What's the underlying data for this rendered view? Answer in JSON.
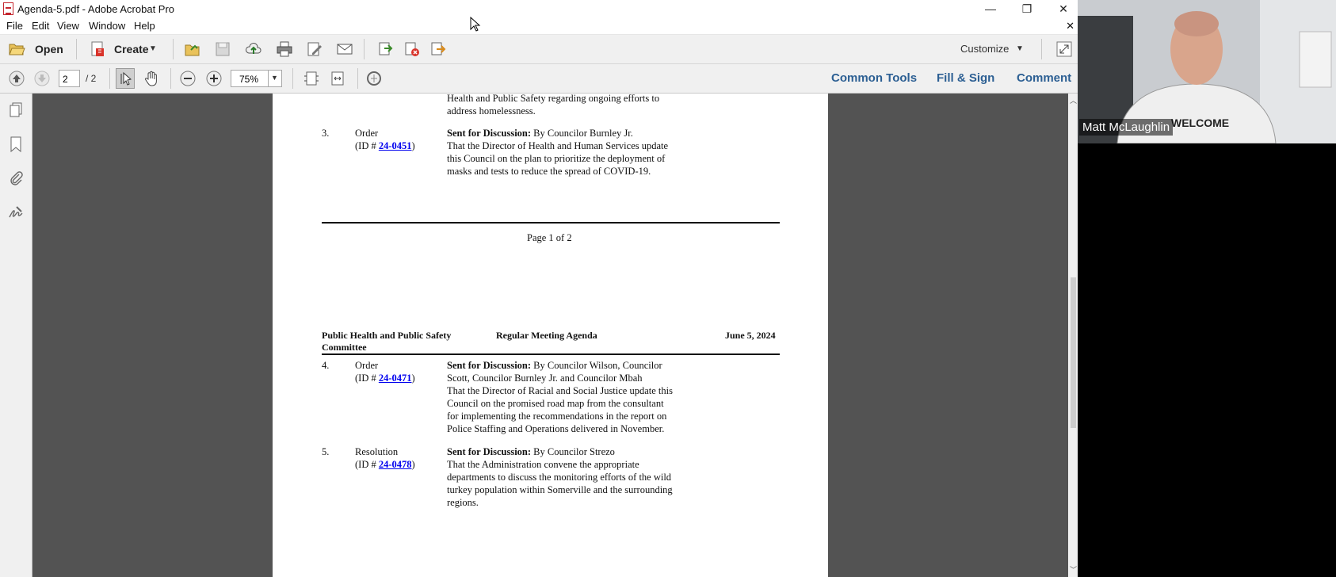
{
  "window": {
    "title": "Agenda-5.pdf - Adobe Acrobat Pro",
    "minimize": "—",
    "maximize": "❐",
    "close": "✕"
  },
  "menu": [
    "File",
    "Edit",
    "View",
    "Window",
    "Help"
  ],
  "menu_close": "✕",
  "toolbar": {
    "open_label": "Open",
    "create_label": "Create",
    "customize_label": "Customize"
  },
  "nav": {
    "page_current": "2",
    "page_total": "/ 2",
    "zoom": "75%",
    "links": [
      "Common Tools",
      "Fill & Sign",
      "Comment"
    ]
  },
  "page1": {
    "item2_tail_line1": "Health and Public Safety regarding ongoing efforts to",
    "item2_tail_line2": "address homelessness.",
    "item3": {
      "num": "3.",
      "type": "Order",
      "id_prefix": "(ID # ",
      "id": "24-0451",
      "id_suffix": ")",
      "status": "Sent for Discussion:",
      "sponsor": " By Councilor Burnley Jr.",
      "lines": [
        "That the Director of Health and Human Services update",
        "this Council on the plan to prioritize the deployment of",
        "masks and tests to reduce the spread of COVID-19."
      ]
    },
    "footer": "Page 1 of 2"
  },
  "page2": {
    "header_left_1": "Public Health and Public Safety",
    "header_left_2": "Committee",
    "header_center": "Regular Meeting Agenda",
    "header_right": "June 5, 2024",
    "item4": {
      "num": "4.",
      "type": "Order",
      "id_prefix": "(ID # ",
      "id": "24-0471",
      "id_suffix": ")",
      "status": "Sent for Discussion:",
      "sponsor": " By Councilor Wilson, Councilor",
      "lines": [
        "Scott, Councilor Burnley Jr. and Councilor Mbah",
        "That the Director of Racial and Social Justice update this",
        "Council on the promised road map from the consultant",
        "for implementing the recommendations in the report on",
        "Police Staffing and Operations delivered in November."
      ]
    },
    "item5": {
      "num": "5.",
      "type": "Resolution",
      "id_prefix": "(ID # ",
      "id": "24-0478",
      "id_suffix": ")",
      "status": "Sent for Discussion:",
      "sponsor": " By Councilor Strezo",
      "lines": [
        "That the Administration convene the appropriate",
        "departments to discuss the monitoring efforts of the wild",
        "turkey population within Somerville and the surrounding",
        "regions."
      ]
    }
  },
  "video": {
    "participant_name": "Matt McLaughlin"
  },
  "colors": {
    "accent_link": "#2c5f93",
    "doc_background": "#535353",
    "hyperlink": "#0000ee"
  }
}
